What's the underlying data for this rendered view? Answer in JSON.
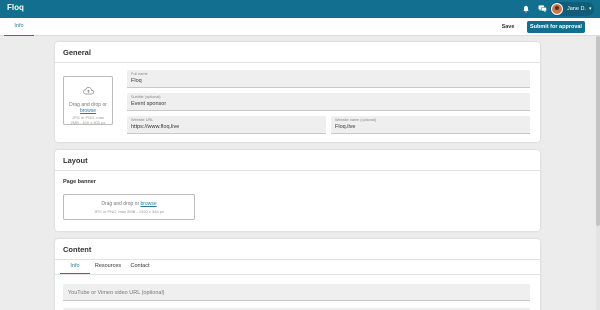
{
  "app": {
    "brand": "Floq"
  },
  "header": {
    "icons": [
      "bell-icon",
      "chat-icon"
    ],
    "user": {
      "name": "Jane D."
    }
  },
  "toolbar": {
    "tab": "Info",
    "save_label": "Save",
    "approve_label": "Submit for approval"
  },
  "general": {
    "title": "General",
    "upload": {
      "text": "Drag and drop or",
      "link": "browse",
      "hint_1": "JPG or PNG, max",
      "hint_2": "2MB - 400 x 400 px"
    },
    "fields": {
      "full_name": {
        "label": "Full name",
        "value": "Floq"
      },
      "subtitle": {
        "label": "Subtitle (optional)",
        "value": "Event sponsor"
      },
      "website_url": {
        "label": "Website URL",
        "value": "https://www.floq.live"
      },
      "website_name": {
        "label": "Website name (optional)",
        "value": "Floq.live"
      }
    }
  },
  "layout": {
    "title": "Layout",
    "banner_label": "Page banner",
    "upload": {
      "text": "Drag and drop or",
      "link": "browse",
      "hint": "JPG or PNG, max 2MB - 1920 x 384 px"
    }
  },
  "content": {
    "title": "Content",
    "tabs": [
      "Info",
      "Resources",
      "Contact"
    ],
    "video_placeholder": "YouTube or Vimeo video URL (optional)"
  },
  "colors": {
    "primary": "#136f8f",
    "accent": "#2a7a9b"
  }
}
